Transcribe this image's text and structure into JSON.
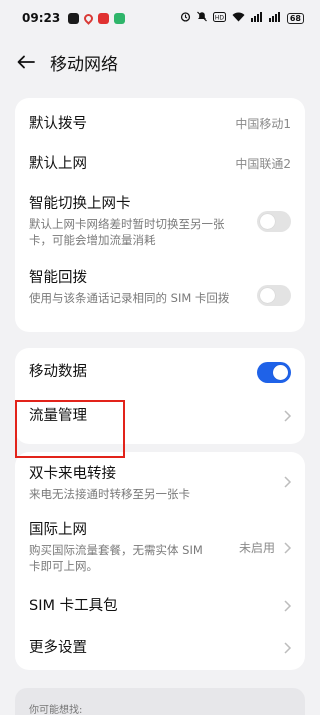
{
  "status_bar": {
    "time": "09:23",
    "battery": "68"
  },
  "header": {
    "title": "移动网络"
  },
  "sim_settings": {
    "default_dial": {
      "label": "默认拨号",
      "value": "中国移动1"
    },
    "default_data": {
      "label": "默认上网",
      "value": "中国联通2"
    },
    "smart_switch": {
      "label": "智能切换上网卡",
      "desc": "默认上网卡网络差时暂时切换至另一张卡，可能会增加流量消耗",
      "enabled": false
    },
    "smart_redial": {
      "label": "智能回拨",
      "desc": "使用与该条通话记录相同的 SIM 卡回拨",
      "enabled": false
    }
  },
  "data_settings": {
    "mobile_data": {
      "label": "移动数据",
      "enabled": true
    },
    "traffic_management": {
      "label": "流量管理"
    }
  },
  "more_settings": {
    "call_forward": {
      "label": "双卡来电转接",
      "desc": "来电无法接通时转移至另一张卡"
    },
    "intl_roaming": {
      "label": "国际上网",
      "desc": "购买国际流量套餐，无需实体 SIM 卡即可上网。",
      "value": "未启用"
    },
    "sim_toolkit": {
      "label": "SIM 卡工具包"
    },
    "more": {
      "label": "更多设置"
    }
  },
  "suggestions": {
    "label": "你可能想找:"
  },
  "colors": {
    "accent": "#1f62e8",
    "highlight": "#e2231a",
    "background": "#f2f2f4"
  }
}
